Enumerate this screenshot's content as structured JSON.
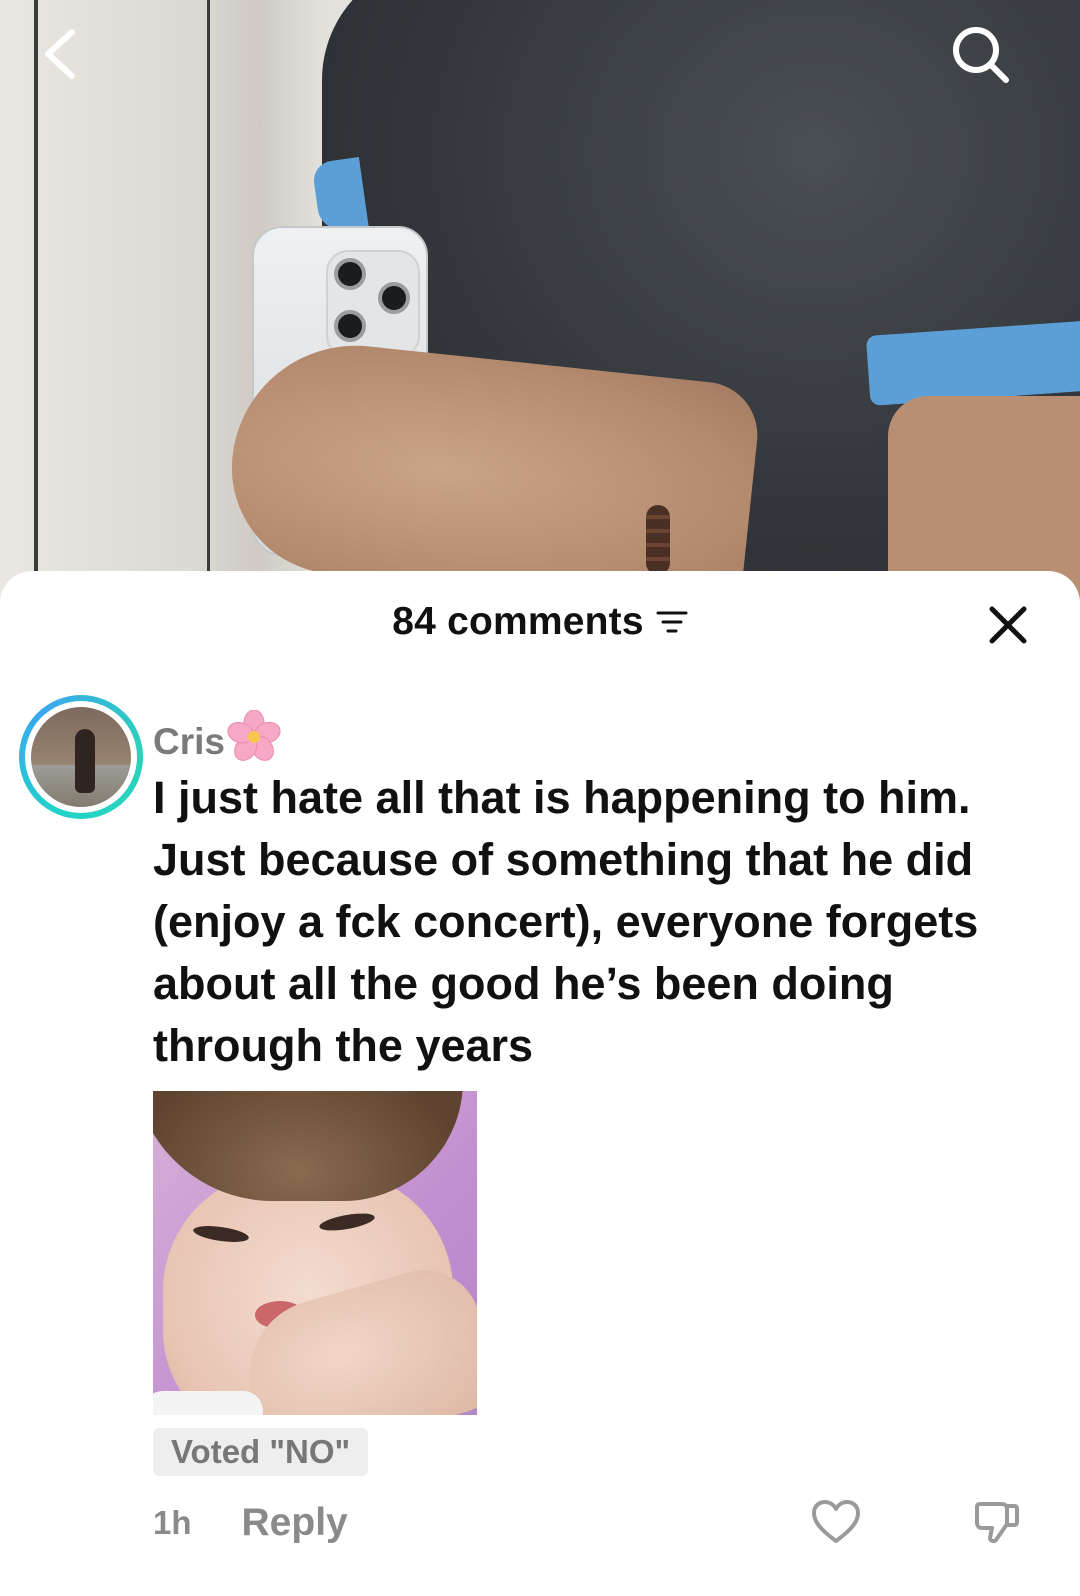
{
  "comments_sheet": {
    "count_label": "84 comments",
    "comment": {
      "username": "Cris",
      "username_emoji": "🌸",
      "text": "I just hate all that is happening to him. Just because of something that he did (enjoy a fck concert), everyone forgets about all the good he’s been doing through the years",
      "vote_badge": "Voted \"NO\"",
      "time_ago": "1h",
      "reply_label": "Reply"
    }
  },
  "colors": {
    "avatar_ring_start": "#20d4c8",
    "avatar_ring_end": "#3aa7f0",
    "muted_text": "#8a8a8a",
    "sleeve_trim": "#5b9fd6"
  },
  "icons": {
    "back": "chevron-left-icon",
    "search": "search-icon",
    "sort": "sort-filter-icon",
    "close": "close-icon",
    "like": "heart-outline-icon",
    "dislike": "thumbs-down-outline-icon"
  }
}
